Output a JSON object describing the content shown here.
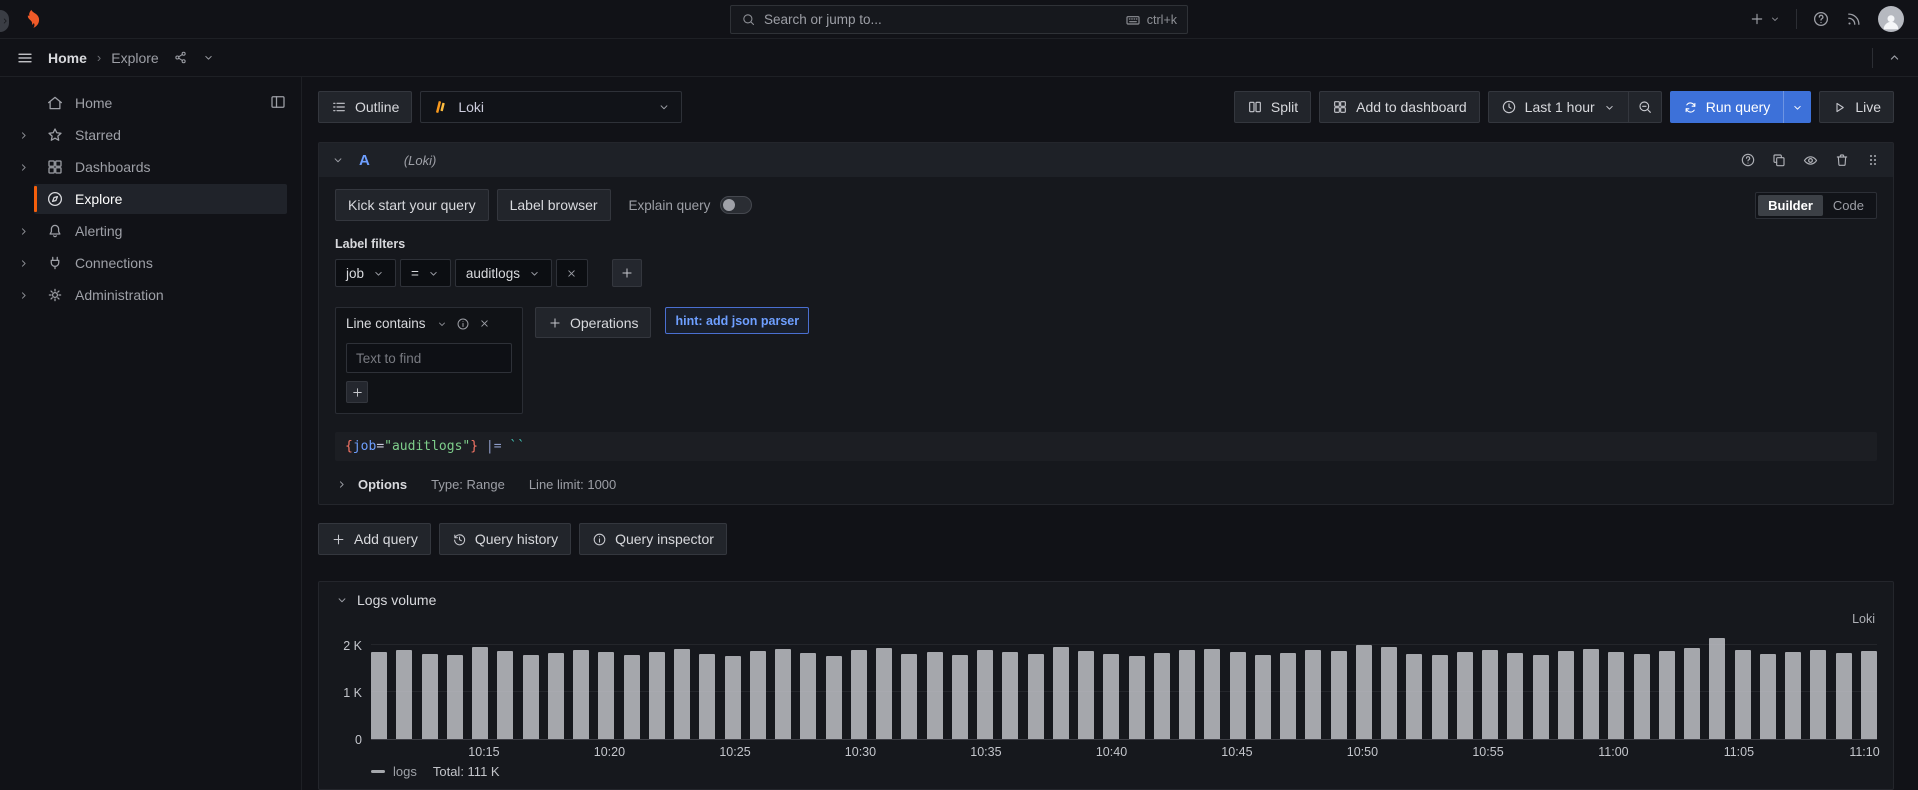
{
  "topnav": {
    "search_placeholder": "Search or jump to...",
    "search_shortcut": "ctrl+k"
  },
  "breadcrumb": {
    "items": [
      "Home",
      "Explore"
    ]
  },
  "sidebar": {
    "items": [
      {
        "label": "Home",
        "icon": "home",
        "chevron": false,
        "active": false
      },
      {
        "label": "Starred",
        "icon": "star",
        "chevron": true,
        "active": false
      },
      {
        "label": "Dashboards",
        "icon": "apps",
        "chevron": true,
        "active": false
      },
      {
        "label": "Explore",
        "icon": "compass",
        "chevron": false,
        "active": true
      },
      {
        "label": "Alerting",
        "icon": "bell",
        "chevron": true,
        "active": false
      },
      {
        "label": "Connections",
        "icon": "plug",
        "chevron": true,
        "active": false
      },
      {
        "label": "Administration",
        "icon": "cog",
        "chevron": true,
        "active": false
      }
    ]
  },
  "toolbar": {
    "outline": "Outline",
    "datasource": "Loki",
    "split": "Split",
    "add_to_dashboard": "Add to dashboard",
    "time_range": "Last 1 hour",
    "run_query": "Run query",
    "live": "Live"
  },
  "query": {
    "ref_id": "A",
    "datasource_hint": "(Loki)",
    "kick_start": "Kick start your query",
    "label_browser": "Label browser",
    "explain": "Explain query",
    "mode_builder": "Builder",
    "mode_code": "Code",
    "label_filters_title": "Label filters",
    "filter": {
      "label": "job",
      "operator": "=",
      "value": "auditlogs"
    },
    "operation_title": "Line contains",
    "text_placeholder": "Text to find",
    "operations_button": "Operations",
    "hint": "hint: add json parser",
    "preview": [
      {
        "t": "{",
        "c": "brace"
      },
      {
        "t": "job",
        "c": "name"
      },
      {
        "t": "=",
        "c": "op"
      },
      {
        "t": "\"auditlogs\"",
        "c": "string"
      },
      {
        "t": "}",
        "c": "brace"
      },
      {
        "t": " |= ",
        "c": "pipe"
      },
      {
        "t": "``",
        "c": "backtick"
      }
    ],
    "options": {
      "title": "Options",
      "type": "Type: Range",
      "line_limit": "Line limit: 1000"
    },
    "add_query": "Add query",
    "query_history": "Query history",
    "query_inspector": "Query inspector"
  },
  "logs_volume": {
    "title": "Logs volume",
    "source_label": "Loki",
    "legend_series": "logs",
    "legend_total": "Total: 111 K"
  },
  "chart_data": {
    "type": "bar",
    "title": "Logs volume",
    "ylabel": "",
    "xlabel": "",
    "ylim": [
      0,
      2000
    ],
    "bar_color": "#a5a7ac",
    "series_name": "logs",
    "total": "111 K",
    "values": [
      1850,
      1900,
      1820,
      1780,
      1950,
      1870,
      1790,
      1830,
      1900,
      1860,
      1780,
      1850,
      1920,
      1800,
      1760,
      1880,
      1910,
      1840,
      1770,
      1890,
      1930,
      1810,
      1850,
      1780,
      1900,
      1860,
      1820,
      1950,
      1870,
      1800,
      1760,
      1840,
      1890,
      1920,
      1850,
      1780,
      1830,
      1900,
      1870,
      2000,
      1950,
      1820,
      1780,
      1860,
      1900,
      1840,
      1790,
      1880,
      1910,
      1850,
      1800,
      1870,
      1930,
      2150,
      1890,
      1820,
      1860,
      1900,
      1840,
      1880
    ],
    "x_ticks": [
      {
        "label": "10:15",
        "bar_index": 4
      },
      {
        "label": "10:20",
        "bar_index": 9
      },
      {
        "label": "10:25",
        "bar_index": 14
      },
      {
        "label": "10:30",
        "bar_index": 19
      },
      {
        "label": "10:35",
        "bar_index": 24
      },
      {
        "label": "10:40",
        "bar_index": 29
      },
      {
        "label": "10:45",
        "bar_index": 34
      },
      {
        "label": "10:50",
        "bar_index": 39
      },
      {
        "label": "10:55",
        "bar_index": 44
      },
      {
        "label": "11:00",
        "bar_index": 49
      },
      {
        "label": "11:05",
        "bar_index": 54
      },
      {
        "label": "11:10",
        "bar_index": 59
      }
    ],
    "y_ticks": [
      {
        "label": "0",
        "value": 0
      },
      {
        "label": "1 K",
        "value": 1000
      },
      {
        "label": "2 K",
        "value": 2000
      }
    ],
    "legend_position": "bottom-left",
    "grid": true
  }
}
